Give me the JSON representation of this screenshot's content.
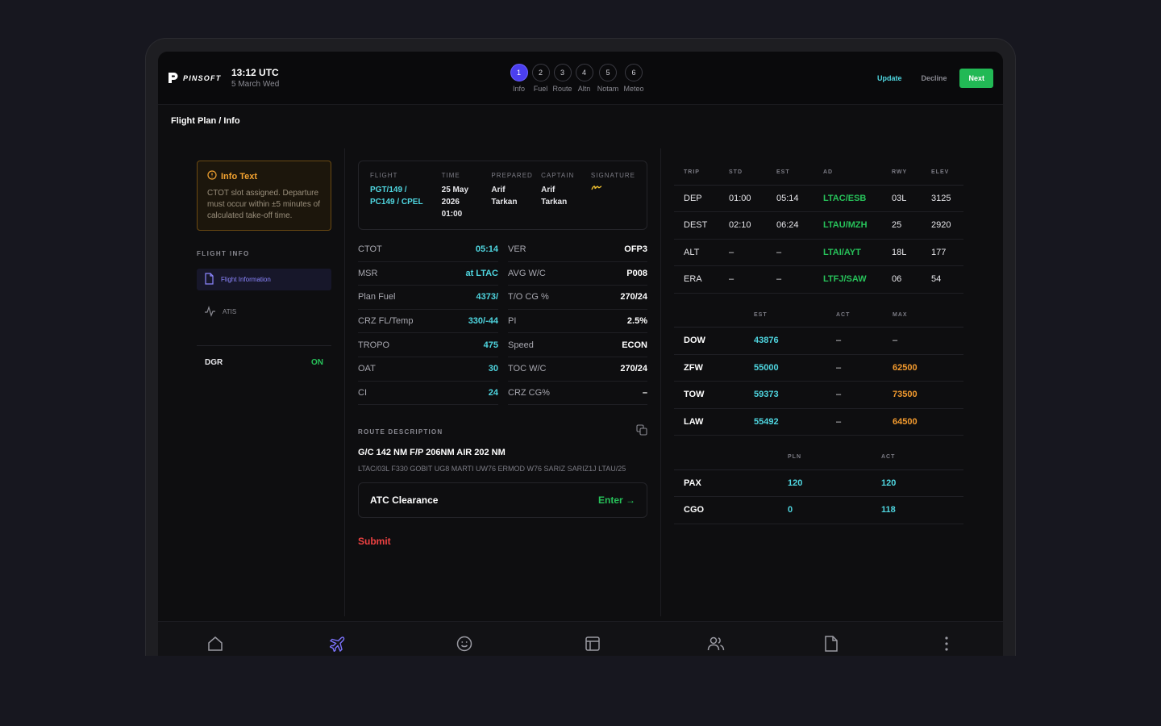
{
  "header": {
    "logo_text": "PINSOFT",
    "time": "13:12 UTC",
    "date": "5 March Wed",
    "steps": [
      {
        "num": "1",
        "label": "Info"
      },
      {
        "num": "2",
        "label": "Fuel"
      },
      {
        "num": "3",
        "label": "Route"
      },
      {
        "num": "4",
        "label": "Altn"
      },
      {
        "num": "5",
        "label": "Notam"
      },
      {
        "num": "6",
        "label": "Meteo"
      }
    ],
    "update": "Update",
    "decline": "Decline",
    "next": "Next"
  },
  "breadcrumb": "Flight Plan / Info",
  "info": {
    "title": "Info Text",
    "body": "CTOT slot assigned. Departure must occur within ±5 minutes of calculated take-off time."
  },
  "sidebar": {
    "section": "FLIGHT INFO",
    "items": [
      {
        "label": "Flight Information"
      },
      {
        "label": "ATIS"
      }
    ],
    "dgr_label": "DGR",
    "dgr_value": "ON"
  },
  "flight_card": {
    "flight_h": "FLIGHT",
    "flight_v1": "PGT/149 /",
    "flight_v2": "PC149 / CPEL",
    "time_h": "TIME",
    "time_v1": "25 May",
    "time_v2": "2026",
    "time_v3": "01:00",
    "prepared_h": "PREPARED",
    "prepared_v1": "Arif",
    "prepared_v2": "Tarkan",
    "captain_h": "CAPTAIN",
    "captain_v1": "Arif",
    "captain_v2": "Tarkan",
    "signature_h": "SIGNATURE"
  },
  "params_left": [
    {
      "k": "CTOT",
      "v": "05:14"
    },
    {
      "k": "MSR",
      "v": "at LTAC"
    },
    {
      "k": "Plan Fuel",
      "v": "4373/"
    },
    {
      "k": "CRZ FL/Temp",
      "v": "330/-44"
    },
    {
      "k": "TROPO",
      "v": "475"
    },
    {
      "k": "OAT",
      "v": "30"
    },
    {
      "k": "CI",
      "v": "24"
    }
  ],
  "params_right": [
    {
      "k": "VER",
      "v": "OFP3"
    },
    {
      "k": "AVG W/C",
      "v": "P008"
    },
    {
      "k": "T/O CG %",
      "v": "270/24"
    },
    {
      "k": "PI",
      "v": "2.5%"
    },
    {
      "k": "Speed",
      "v": "ECON"
    },
    {
      "k": "TOC W/C",
      "v": "270/24"
    },
    {
      "k": "CRZ CG%",
      "v": "–"
    }
  ],
  "route": {
    "title": "ROUTE DESCRIPTION",
    "main": "G/C 142 NM F/P 206NM AIR 202 NM",
    "sub": "LTAC/03L F330 GOBIT UG8 MARTI UW76 ERMOD W76 SARIZ SARIZ1J LTAU/25"
  },
  "atc": {
    "label": "ATC Clearance",
    "enter": "Enter →"
  },
  "submit": "Submit",
  "trip_table": {
    "headers": [
      "TRIP",
      "STD",
      "EST",
      "AD",
      "RWY",
      "ELEV"
    ],
    "rows": [
      [
        "DEP",
        "01:00",
        "05:14",
        "LTAC/ESB",
        "03L",
        "3125"
      ],
      [
        "DEST",
        "02:10",
        "06:24",
        "LTAU/MZH",
        "25",
        "2920"
      ],
      [
        "ALT",
        "–",
        "–",
        "LTAI/AYT",
        "18L",
        "177"
      ],
      [
        "ERA",
        "–",
        "–",
        "LTFJ/SAW",
        "06",
        "54"
      ]
    ]
  },
  "weight_table": {
    "headers": [
      "",
      "EST",
      "ACT",
      "MAX"
    ],
    "rows": [
      [
        "DOW",
        "43876",
        "–",
        "–"
      ],
      [
        "ZFW",
        "55000",
        "–",
        "62500"
      ],
      [
        "TOW",
        "59373",
        "–",
        "73500"
      ],
      [
        "LAW",
        "55492",
        "–",
        "64500"
      ]
    ]
  },
  "load_table": {
    "headers": [
      "",
      "PLN",
      "ACT"
    ],
    "rows": [
      [
        "PAX",
        "120",
        "120"
      ],
      [
        "CGO",
        "0",
        "118"
      ]
    ]
  },
  "colors": {
    "accent": "#4b3ff0",
    "cyan": "#4fd6e0",
    "green": "#22b955",
    "orange": "#f29a2e",
    "red": "#ef4242"
  },
  "bottom_icons": [
    "home-icon",
    "plane-icon",
    "smile-icon",
    "layout-icon",
    "users-icon",
    "file-icon",
    "more-icon"
  ]
}
